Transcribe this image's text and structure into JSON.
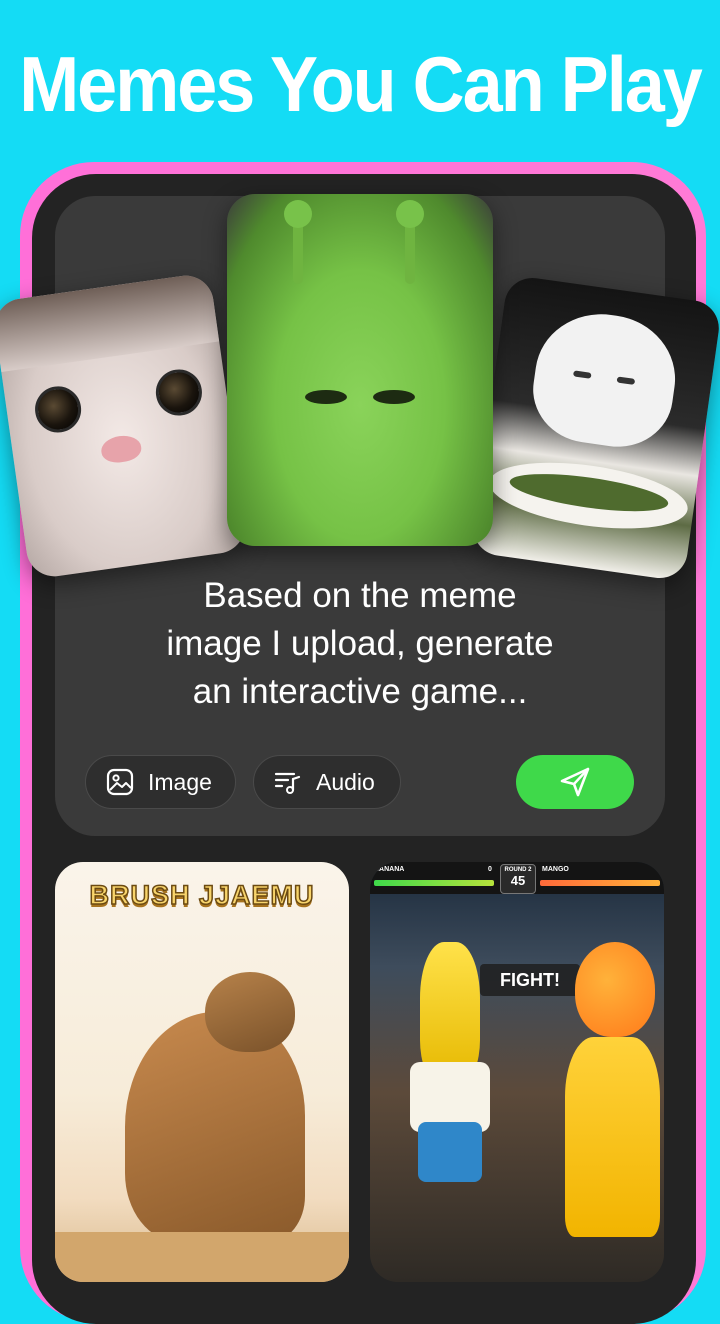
{
  "headline": "Memes You Can Play",
  "prompt": {
    "text_lines": [
      "Based on the meme",
      "image I upload, generate",
      "an interactive game..."
    ]
  },
  "chips": {
    "image_label": "Image",
    "audio_label": "Audio"
  },
  "icons": {
    "image": "image-icon",
    "audio": "music-note-icon",
    "send": "send-paper-plane-icon"
  },
  "colors": {
    "background": "#14dcf5",
    "frame": "#ff6fd8",
    "send_button": "#3fd94a"
  },
  "game_brush": {
    "title": "BRUSH JJAEMU"
  },
  "game_fight": {
    "player1": "BANANA",
    "player1_score": "0",
    "round_label": "ROUND 2",
    "round_number": "45",
    "player2": "MANGO",
    "banner": "FIGHT!"
  }
}
